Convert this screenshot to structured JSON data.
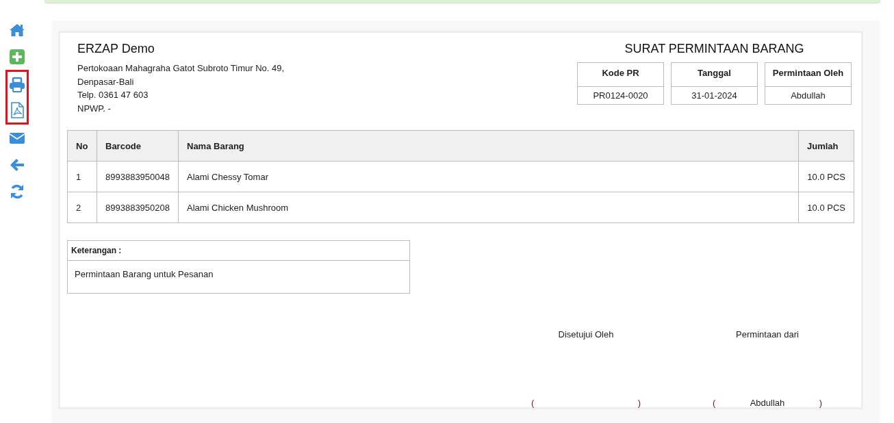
{
  "sidebar": {
    "items": [
      {
        "kind": "home",
        "highlighted": false
      },
      {
        "kind": "add",
        "highlighted": false
      },
      {
        "kind": "print",
        "highlighted": true
      },
      {
        "kind": "pdf",
        "highlighted": true
      },
      {
        "kind": "mail",
        "highlighted": false
      },
      {
        "kind": "back",
        "highlighted": false
      },
      {
        "kind": "refresh",
        "highlighted": false
      }
    ]
  },
  "company": {
    "name": "ERZAP Demo",
    "address_lines": [
      "Pertokoaan Mahagraha Gatot Subroto Timur No. 49,",
      "Denpasar-Bali",
      "Telp. 0361 47 603",
      "NPWP. -"
    ]
  },
  "document": {
    "title": "SURAT PERMINTAAN BARANG",
    "info": [
      {
        "label": "Kode PR",
        "value": "PR0124-0020"
      },
      {
        "label": "Tanggal",
        "value": "31-01-2024"
      },
      {
        "label": "Permintaan Oleh",
        "value": "Abdullah"
      }
    ]
  },
  "table": {
    "columns": [
      "No",
      "Barcode",
      "Nama Barang",
      "Jumlah"
    ],
    "rows": [
      [
        "1",
        "8993883950048",
        "Alami Chessy Tomar",
        "10.0 PCS"
      ],
      [
        "2",
        "8993883950208",
        "Alami Chicken Mushroom",
        "10.0 PCS"
      ]
    ]
  },
  "notes": {
    "label": "Keterangan :",
    "text": "Permintaan Barang untuk Pesanan"
  },
  "signatures": [
    {
      "title": "Disetujui Oleh",
      "open": "(",
      "close": ")"
    },
    {
      "title": "Permintaan dari",
      "open": "(",
      "name": "Abdullah",
      "close": ")"
    }
  ]
}
